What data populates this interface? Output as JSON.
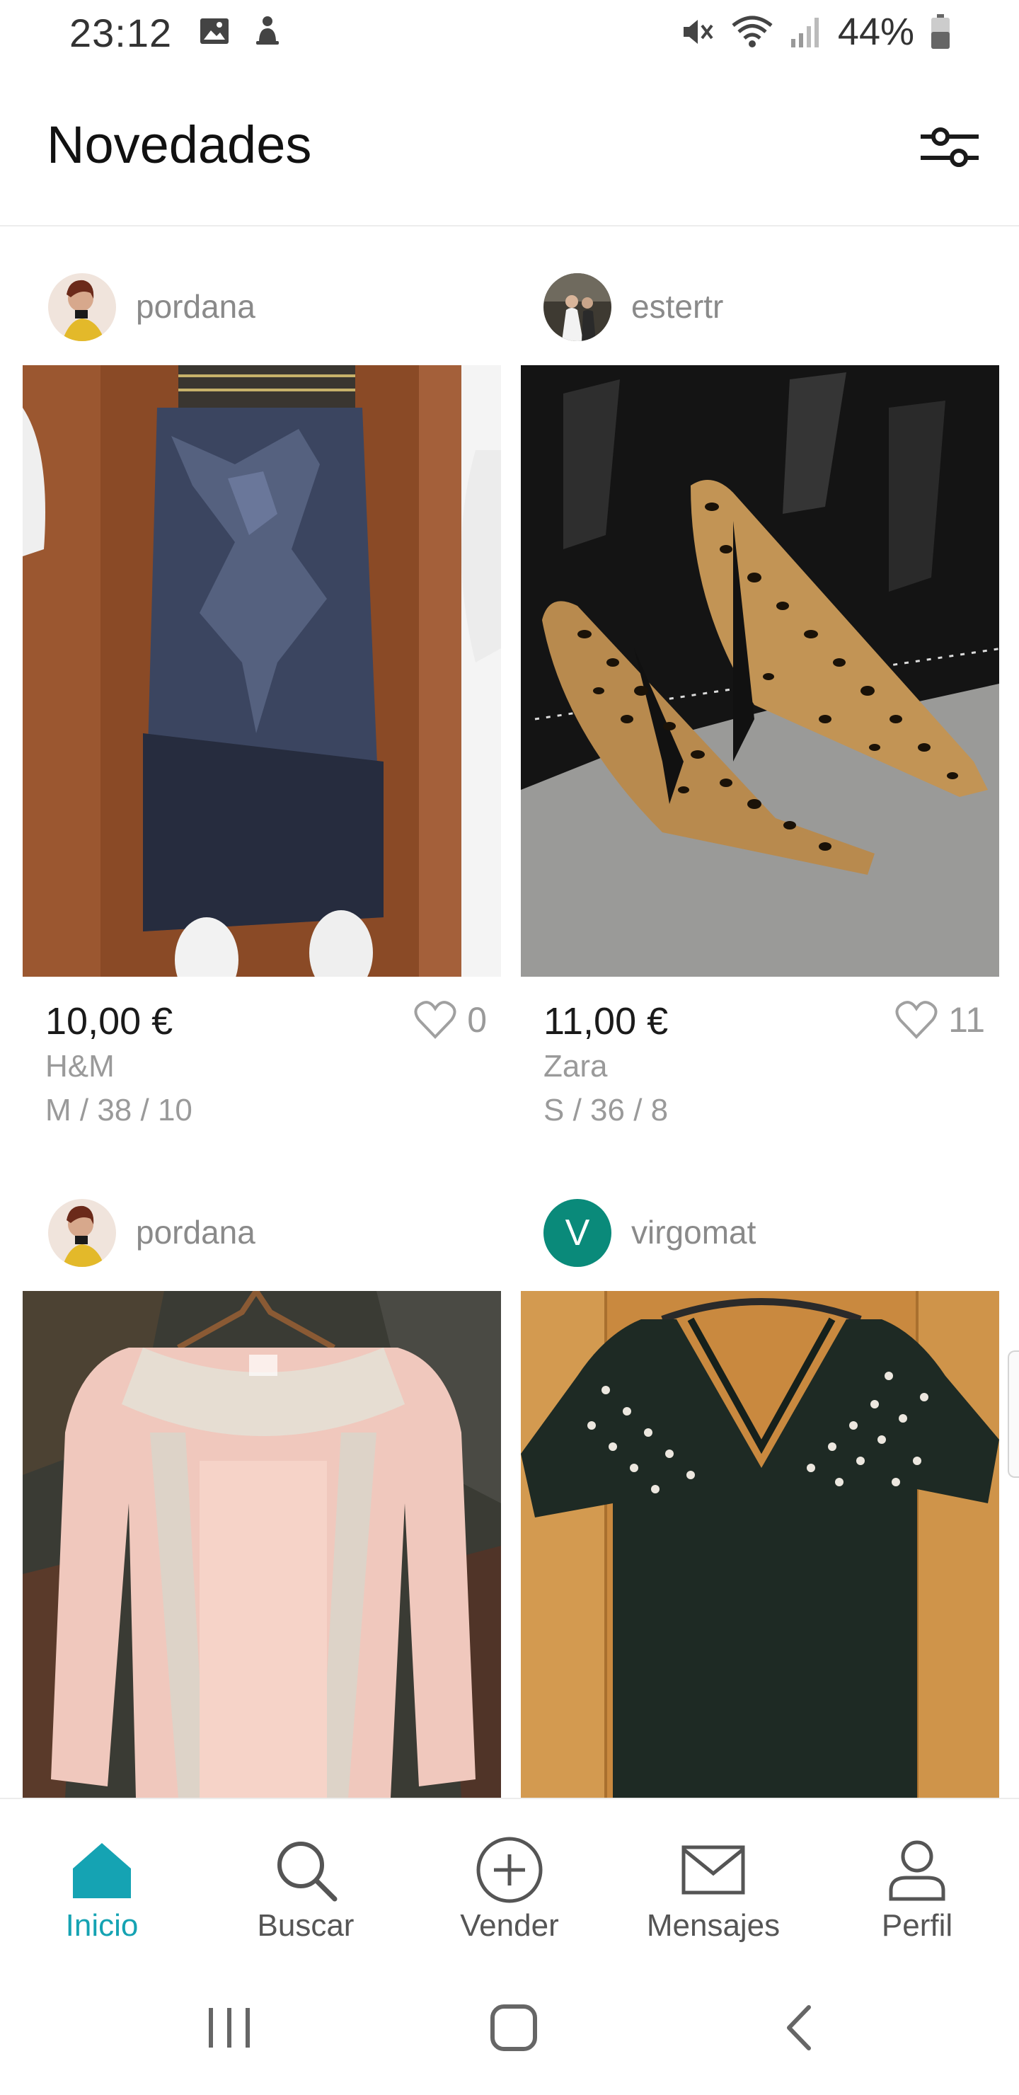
{
  "status": {
    "time": "23:12",
    "battery": "44%",
    "left_icons": [
      "image-icon",
      "notification-icon"
    ],
    "right_icons": [
      "mute-icon",
      "wifi-icon",
      "signal-icon",
      "battery-icon"
    ]
  },
  "header": {
    "title": "Novedades",
    "filter_icon": "filter-sliders-icon"
  },
  "feed": {
    "items": [
      {
        "user": "pordana",
        "price": "10,00 €",
        "likes": "0",
        "brand": "H&M",
        "size": "M / 38 / 10",
        "avatar_type": "photo",
        "image": "navy-skirt-with-bow"
      },
      {
        "user": "estertr",
        "price": "11,00 €",
        "likes": "11",
        "brand": "Zara",
        "size": "S / 36 / 8",
        "avatar_type": "photo",
        "image": "leopard-print-heels"
      },
      {
        "user": "pordana",
        "price": "",
        "likes": "",
        "brand": "",
        "size": "",
        "avatar_type": "photo",
        "image": "pink-lace-blouse"
      },
      {
        "user": "virgomat",
        "avatar_letter": "V",
        "price": "",
        "likes": "",
        "brand": "",
        "size": "",
        "avatar_type": "letter",
        "image": "dark-green-pearl-top"
      }
    ]
  },
  "nav": {
    "items": [
      {
        "label": "Inicio",
        "icon": "home-icon",
        "active": true
      },
      {
        "label": "Buscar",
        "icon": "search-icon",
        "active": false
      },
      {
        "label": "Vender",
        "icon": "plus-circle-icon",
        "active": false
      },
      {
        "label": "Mensajes",
        "icon": "mail-icon",
        "active": false
      },
      {
        "label": "Perfil",
        "icon": "profile-icon",
        "active": false
      }
    ]
  },
  "colors": {
    "accent": "#15a3b3",
    "avatar_v": "#0a8a7a"
  }
}
